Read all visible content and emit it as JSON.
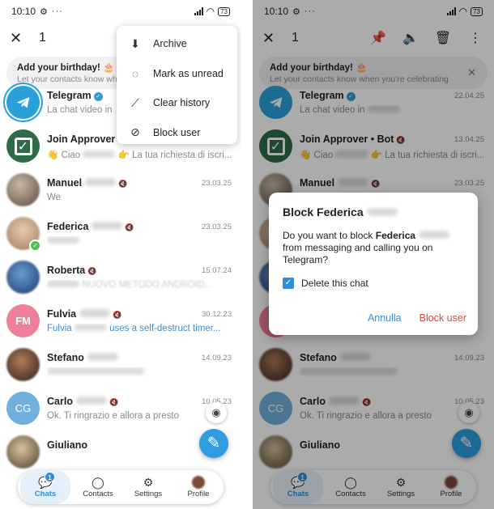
{
  "status": {
    "time": "10:10",
    "battery": "73"
  },
  "topbar": {
    "selected_count": "1"
  },
  "birthday": {
    "title": "Add your birthday! 🎂",
    "subtitle_left": "Let your contacts know wher",
    "subtitle_right": "Let your contacts know when you're celebrating"
  },
  "context_menu": {
    "items": [
      {
        "label": "Archive",
        "icon": "archive-icon"
      },
      {
        "label": "Mark as unread",
        "icon": "chat-unread-icon"
      },
      {
        "label": "Clear history",
        "icon": "broom-icon"
      },
      {
        "label": "Block user",
        "icon": "block-icon"
      }
    ]
  },
  "chats_left": [
    {
      "name": "Telegram",
      "date": "",
      "preview": "La chat video in"
    },
    {
      "name": "Join Approver • ",
      "date": "",
      "preview_prefix": "👋 Ciao",
      "preview_suffix": "👉 La tua richiesta di iscri..."
    },
    {
      "name": "Manuel",
      "date": "23.03.25",
      "preview": "We"
    },
    {
      "name": "Federica",
      "date": "23.03.25",
      "preview": ""
    },
    {
      "name": "Roberta",
      "date": "15.07.24",
      "preview": "NUOVO METODO ANDROID..."
    },
    {
      "name": "Fulvia",
      "date": "30.12.23",
      "preview_prefix": "Fulvia",
      "preview_suffix": "uses a self-destruct timer..."
    },
    {
      "name": "Stefano",
      "date": "14.09.23",
      "preview": ""
    },
    {
      "name": "Carlo",
      "date": "10.05.23",
      "preview": "Ok. Ti ringrazio e allora a presto"
    },
    {
      "name": "Giuliano",
      "date": "",
      "preview": ""
    }
  ],
  "chats_right": [
    {
      "name": "Telegram",
      "date": "22.04.25",
      "preview": "La chat video in"
    },
    {
      "name": "Join Approver • Bot",
      "date": "13.04.25",
      "preview_prefix": "👋 Ciao",
      "preview_suffix": "👉 La tua richiesta di iscri..."
    },
    {
      "name": "Manuel",
      "date": "23.03.25",
      "preview": "We"
    },
    {
      "name": "Stefano",
      "date": "14.09.23",
      "preview": ""
    },
    {
      "name": "Carlo",
      "date": "10.05.23",
      "preview": "Ok. Ti ringrazio e allora a presto"
    },
    {
      "name": "Giuliano",
      "date": "",
      "preview": ""
    }
  ],
  "avatar_initials": {
    "fulvia": "FM",
    "carlo": "CG"
  },
  "nav": {
    "badge": "1",
    "items": [
      {
        "label": "Chats",
        "icon": "chats-icon"
      },
      {
        "label": "Contacts",
        "icon": "contacts-icon"
      },
      {
        "label": "Settings",
        "icon": "settings-icon"
      },
      {
        "label": "Profile",
        "icon": "profile-icon"
      }
    ]
  },
  "dialog": {
    "title": "Block Federica",
    "body_start": "Do you want to block",
    "body_name": "Federica",
    "body_end": "from messaging and calling you on Telegram?",
    "checkbox_label": "Delete this chat",
    "checkbox_checked": true,
    "cancel_label": "Annulla",
    "confirm_label": "Block user"
  },
  "colors": {
    "accent": "#2e8fd8",
    "danger": "#d64a4a",
    "fab": "#2e9ee0"
  }
}
